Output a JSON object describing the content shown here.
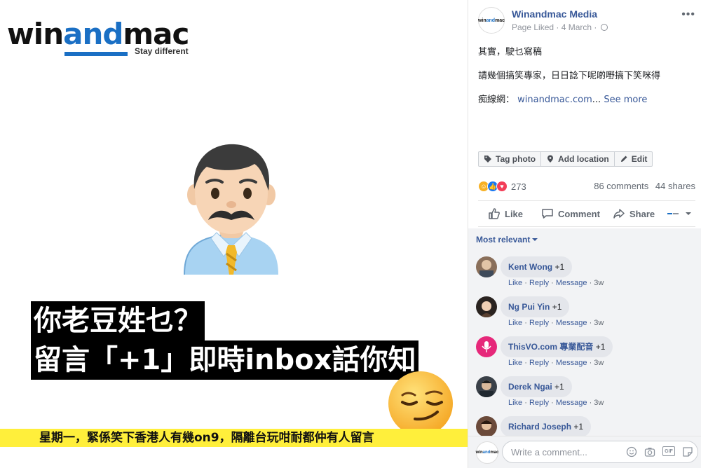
{
  "media": {
    "logo_prefix": "win",
    "logo_accent": "and",
    "logo_suffix": "mac",
    "logo_tagline": "Stay different",
    "caption_line1": "你老豆姓乜？",
    "caption_line2": "留言「+1」即時inbox話你知",
    "ticker": "星期一，緊係笑下香港人有幾on9，隔離台玩咁耐都仲有人留言",
    "man_emoji": "man-office-worker-emoji",
    "smirk_emoji": "smirking-face-emoji"
  },
  "post": {
    "page_name": "Winandmac Media",
    "avatar_text_prefix": "win",
    "avatar_text_accent": "and",
    "avatar_text_suffix": "mac",
    "meta": "Page Liked · 4 March ·",
    "text_line1": "其實，駛乜寫稿",
    "text_line2": "請幾個搞笑專家，日日諗下呢啲嘢搞下笑咪得",
    "text_line3_prefix": "痴線網：",
    "text_line3_link": "winandmac.com",
    "text_line3_ellipsis": "...",
    "see_more": "See more",
    "actions": {
      "tag_photo": "Tag photo",
      "add_location": "Add location",
      "edit": "Edit"
    },
    "reactions_count": "273",
    "comments_count": "86 comments",
    "shares_count": "44 shares",
    "like_label": "Like",
    "comment_label": "Comment",
    "share_label": "Share"
  },
  "comments": {
    "sort_label": "Most relevant",
    "items": [
      {
        "name": "Kent Wong",
        "text": "+1",
        "like": "Like",
        "reply": "Reply",
        "message": "Message",
        "time": "3w"
      },
      {
        "name": "Ng Pui Yin",
        "text": "+1",
        "like": "Like",
        "reply": "Reply",
        "message": "Message",
        "time": "3w"
      },
      {
        "name": "ThisVO.com 專業配音",
        "text": "+1",
        "like": "Like",
        "reply": "Reply",
        "message": "Message",
        "time": "3w"
      },
      {
        "name": "Derek Ngai",
        "text": "+1",
        "like": "Like",
        "reply": "Reply",
        "message": "Message",
        "time": "3w"
      },
      {
        "name": "Richard Joseph",
        "text": "+1"
      }
    ],
    "write_placeholder": "Write a comment..."
  },
  "colors": {
    "link": "#385898",
    "accent": "#1a6fc4",
    "ticker_bg": "#ffef3b"
  }
}
